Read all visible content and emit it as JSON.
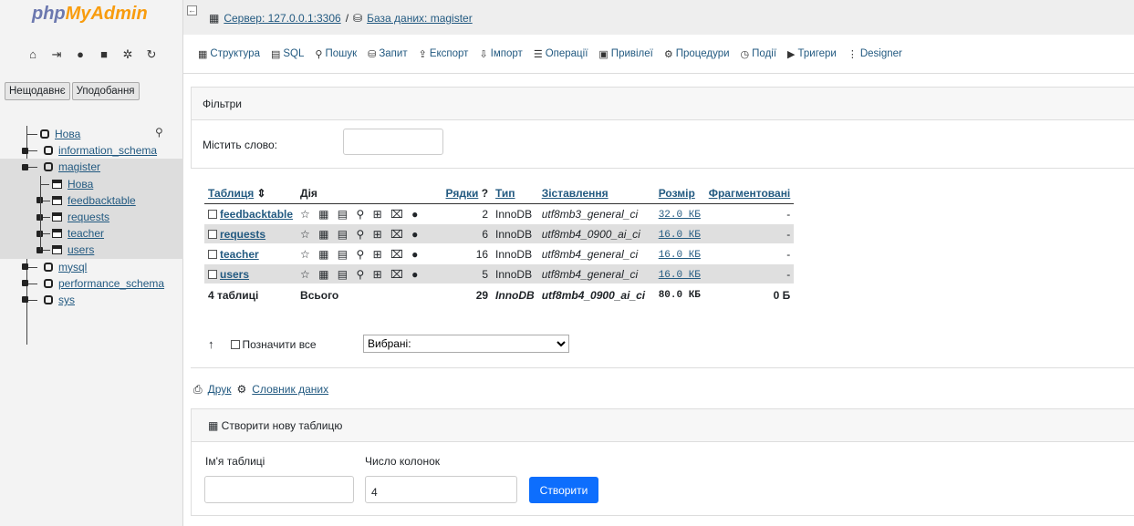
{
  "logo": {
    "part1": "php",
    "part2": "MyAdmin"
  },
  "left_tabs": [
    "Нещодавнє",
    "Уподобання"
  ],
  "tree": {
    "new": "Нова",
    "databases": [
      {
        "name": "information_schema"
      },
      {
        "name": "magister"
      },
      {
        "name": "mysql"
      },
      {
        "name": "performance_schema"
      },
      {
        "name": "sys"
      }
    ],
    "magister_children": [
      "Нова",
      "feedbacktable",
      "requests",
      "teacher",
      "users"
    ]
  },
  "breadcrumb": {
    "server": "Сервер: 127.0.0.1:3306",
    "sep": "/",
    "db": "База даних: magister"
  },
  "menu": [
    {
      "icon": "structure-icon",
      "label": "Структура"
    },
    {
      "icon": "sql-icon",
      "label": "SQL"
    },
    {
      "icon": "search-icon",
      "label": "Пошук"
    },
    {
      "icon": "query-icon",
      "label": "Запит"
    },
    {
      "icon": "export-icon",
      "label": "Експорт"
    },
    {
      "icon": "import-icon",
      "label": "Імпорт"
    },
    {
      "icon": "operations-icon",
      "label": "Операції"
    },
    {
      "icon": "privileges-icon",
      "label": "Привілеї"
    },
    {
      "icon": "procedures-icon",
      "label": "Процедури"
    },
    {
      "icon": "events-icon",
      "label": "Події"
    },
    {
      "icon": "triggers-icon",
      "label": "Тригери"
    },
    {
      "icon": "designer-icon",
      "label": "Designer"
    }
  ],
  "filters": {
    "title": "Фільтри",
    "label": "Містить слово:",
    "value": ""
  },
  "table": {
    "headers": {
      "table": "Таблиця",
      "action": "Дія",
      "rows": "Рядки",
      "type": "Тип",
      "collation": "Зіставлення",
      "size": "Розмір",
      "overhead": "Фрагментовані"
    },
    "rows": [
      {
        "name": "feedbacktable",
        "rows": "2",
        "type": "InnoDB",
        "collation": "utf8mb3_general_ci",
        "size": "32.0 КБ",
        "overhead": "-"
      },
      {
        "name": "requests",
        "rows": "6",
        "type": "InnoDB",
        "collation": "utf8mb4_0900_ai_ci",
        "size": "16.0 КБ",
        "overhead": "-"
      },
      {
        "name": "teacher",
        "rows": "16",
        "type": "InnoDB",
        "collation": "utf8mb4_general_ci",
        "size": "16.0 КБ",
        "overhead": "-"
      },
      {
        "name": "users",
        "rows": "5",
        "type": "InnoDB",
        "collation": "utf8mb4_general_ci",
        "size": "16.0 КБ",
        "overhead": "-"
      }
    ],
    "summary": {
      "name": "4 таблиці",
      "action": "Всього",
      "rows": "29",
      "type": "InnoDB",
      "collation": "utf8mb4_0900_ai_ci",
      "size": "80.0 КБ",
      "overhead": "0 Б"
    }
  },
  "select_all": "Позначити все",
  "with_selected": "Вибрані:",
  "print": "Друк",
  "data_dict": "Словник даних",
  "create": {
    "title": "Створити нову таблицю",
    "name_label": "Ім'я таблиці",
    "cols_label": "Число колонок",
    "cols_value": "4",
    "button": "Створити"
  }
}
